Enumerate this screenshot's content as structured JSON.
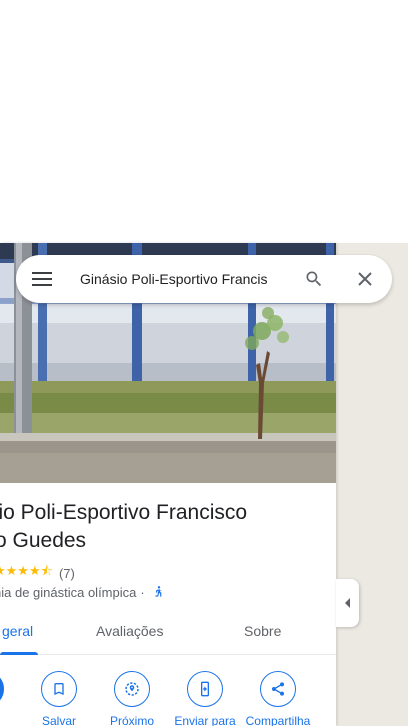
{
  "search": {
    "value": "Ginásio Poli-Esportivo Francis"
  },
  "place": {
    "title_line1": "sio Poli-Esportivo Francisco",
    "title_line2": "ro Guedes",
    "rating": 4.3,
    "stars_text": "★★★★⯪",
    "review_count": "(7)",
    "category": "nia de ginástica olímpica",
    "separator": "·"
  },
  "tabs": [
    {
      "label": "geral",
      "active": true
    },
    {
      "label": "Avaliações",
      "active": false
    },
    {
      "label": "Sobre",
      "active": false
    }
  ],
  "actions": [
    {
      "label": "",
      "icon": "directions-icon"
    },
    {
      "label": "Salvar",
      "icon": "bookmark-icon"
    },
    {
      "label": "Próximo",
      "icon": "nearby-icon"
    },
    {
      "label": "Enviar para",
      "icon": "send-to-phone-icon"
    },
    {
      "label": "Compartilha",
      "icon": "share-icon"
    }
  ],
  "colors": {
    "accent": "#1a73e8",
    "star": "#fbbc04",
    "map_bg": "#ece9e2"
  }
}
